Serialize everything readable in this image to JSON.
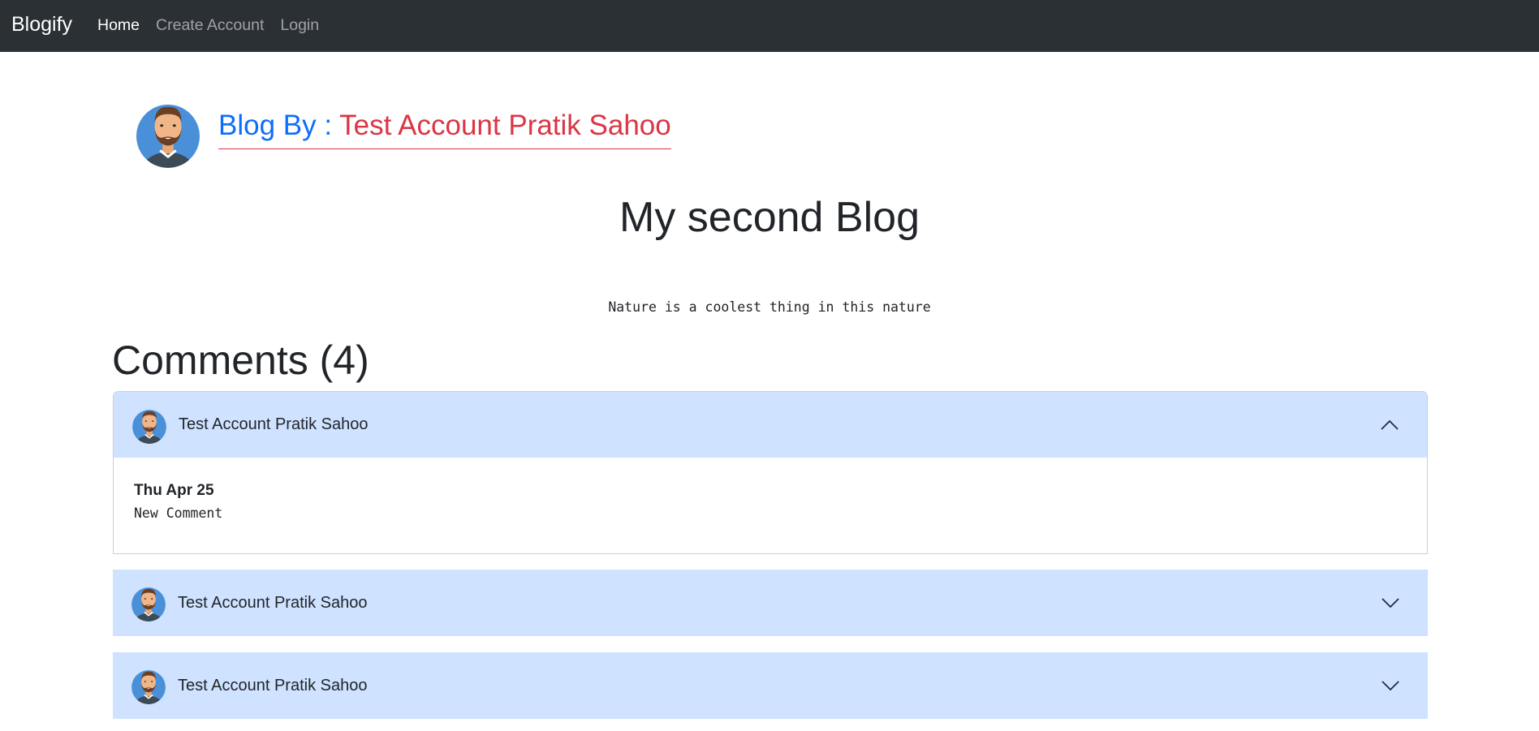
{
  "navbar": {
    "brand": "Blogify",
    "links": [
      "Home",
      "Create Account",
      "Login"
    ]
  },
  "author": {
    "prefix": "Blog By : ",
    "name": "Test Account Pratik Sahoo"
  },
  "post": {
    "title": "My second Blog",
    "body": "Nature is a coolest thing in this nature"
  },
  "comments": {
    "heading": "Comments (4)",
    "items": [
      {
        "author": "Test Account Pratik Sahoo",
        "date": "Thu Apr 25",
        "text": "New Comment",
        "expanded": true
      },
      {
        "author": "Test Account Pratik Sahoo",
        "expanded": false
      },
      {
        "author": "Test Account Pratik Sahoo",
        "expanded": false
      }
    ]
  },
  "colors": {
    "navbar_bg": "#2b3035",
    "accent_blue": "#0d6efd",
    "accent_red": "#dc3545",
    "accordion_header_bg": "#cfe2ff"
  },
  "icons": [
    "avatar-icon",
    "chevron-up-icon",
    "chevron-down-icon"
  ]
}
